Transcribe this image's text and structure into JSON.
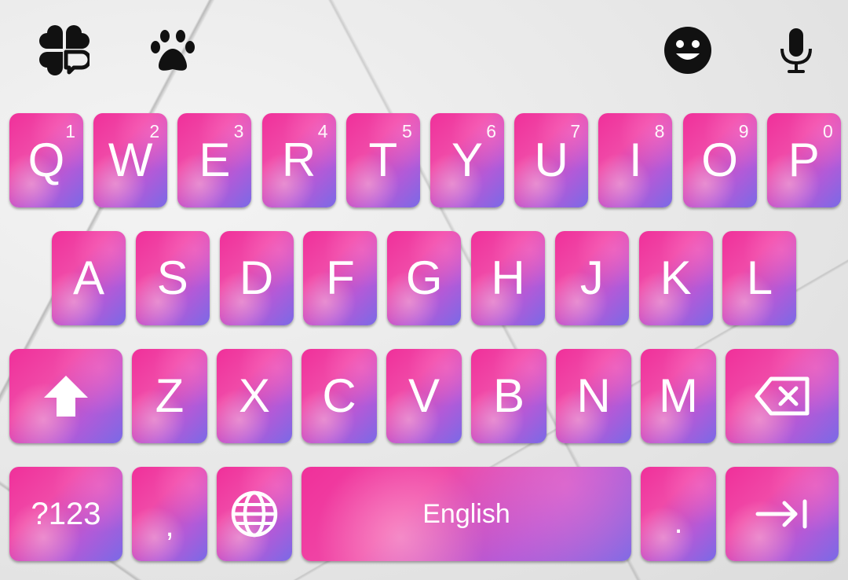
{
  "toolbar": {
    "icons": [
      "clover-icon",
      "paw-icon",
      "emoji-icon",
      "microphone-icon"
    ]
  },
  "rows": {
    "row1": [
      {
        "letter": "Q",
        "num": "1"
      },
      {
        "letter": "W",
        "num": "2"
      },
      {
        "letter": "E",
        "num": "3"
      },
      {
        "letter": "R",
        "num": "4"
      },
      {
        "letter": "T",
        "num": "5"
      },
      {
        "letter": "Y",
        "num": "6"
      },
      {
        "letter": "U",
        "num": "7"
      },
      {
        "letter": "I",
        "num": "8"
      },
      {
        "letter": "O",
        "num": "9"
      },
      {
        "letter": "P",
        "num": "0"
      }
    ],
    "row2": [
      "A",
      "S",
      "D",
      "F",
      "G",
      "H",
      "J",
      "K",
      "L"
    ],
    "row3": [
      "Z",
      "X",
      "C",
      "V",
      "B",
      "N",
      "M"
    ]
  },
  "bottom": {
    "symbols_label": "?123",
    "comma_label": ",",
    "space_label": "English",
    "period_label": "."
  },
  "colors": {
    "key_pink": "#f0309a",
    "key_purple": "#7a6ae6",
    "key_text": "#ffffff",
    "icon": "#111111"
  }
}
